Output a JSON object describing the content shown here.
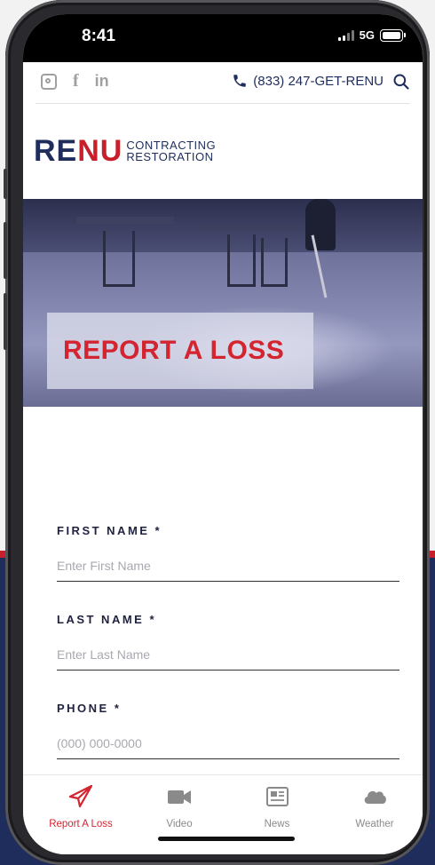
{
  "status_bar": {
    "time": "8:41",
    "network": "5G"
  },
  "header": {
    "phone_text": "(833) 247-GET-RENU",
    "social": [
      "instagram-icon",
      "facebook-icon",
      "linkedin-icon"
    ],
    "facebook_glyph": "f",
    "linkedin_glyph": "in"
  },
  "logo": {
    "re": "RE",
    "nu": "NU",
    "line1": "CONTRACTING",
    "line2": "RESTORATION"
  },
  "hero": {
    "title": "REPORT A LOSS"
  },
  "form": {
    "fields": [
      {
        "label": "FIRST NAME *",
        "placeholder": "Enter First Name"
      },
      {
        "label": "LAST NAME *",
        "placeholder": "Enter Last Name"
      },
      {
        "label": "PHONE *",
        "placeholder": "(000) 000-0000"
      }
    ]
  },
  "tabs": [
    {
      "label": "Report A Loss",
      "icon": "paper-plane-icon",
      "active": true
    },
    {
      "label": "Video",
      "icon": "video-camera-icon",
      "active": false
    },
    {
      "label": "News",
      "icon": "newspaper-icon",
      "active": false
    },
    {
      "label": "Weather",
      "icon": "cloud-icon",
      "active": false
    }
  ],
  "colors": {
    "navy": "#1f2d5c",
    "red": "#d3242f",
    "muted": "#8a8a8a"
  }
}
